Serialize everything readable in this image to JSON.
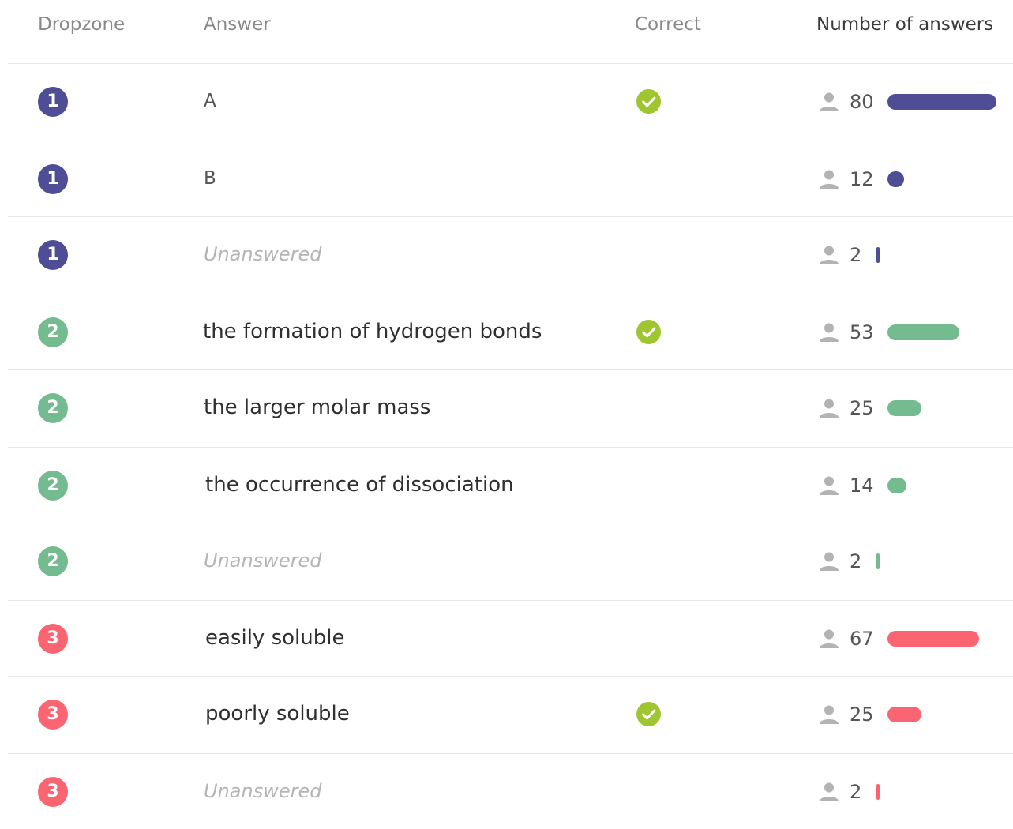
{
  "headers": {
    "dropzone": "Dropzone",
    "answer": "Answer",
    "correct": "Correct",
    "count": "Number of answers"
  },
  "colors": {
    "zone_1": "#4f4d96",
    "zone_2": "#74bb8f",
    "zone_3": "#fb6571",
    "check": "#9fc631",
    "user_icon": "#b3b3b3"
  },
  "max_count": 80,
  "rows": [
    {
      "zone": "1",
      "answer": "A",
      "correct": true,
      "count": "80"
    },
    {
      "zone": "1",
      "answer": "B",
      "correct": false,
      "count": "12"
    },
    {
      "zone": "1",
      "answer": "Unanswered",
      "correct": false,
      "count": "2"
    },
    {
      "zone": "2",
      "answer": "the formation of hydrogen bonds",
      "correct": true,
      "count": "53"
    },
    {
      "zone": "2",
      "answer": "the larger molar mass",
      "correct": false,
      "count": "25"
    },
    {
      "zone": "2",
      "answer": "the occurrence of dissociation",
      "correct": false,
      "count": "14"
    },
    {
      "zone": "2",
      "answer": "Unanswered",
      "correct": false,
      "count": "2"
    },
    {
      "zone": "3",
      "answer": "easily soluble",
      "correct": false,
      "count": "67"
    },
    {
      "zone": "3",
      "answer": "poorly soluble",
      "correct": true,
      "count": "25"
    },
    {
      "zone": "3",
      "answer": "Unanswered",
      "correct": false,
      "count": "2"
    }
  ]
}
